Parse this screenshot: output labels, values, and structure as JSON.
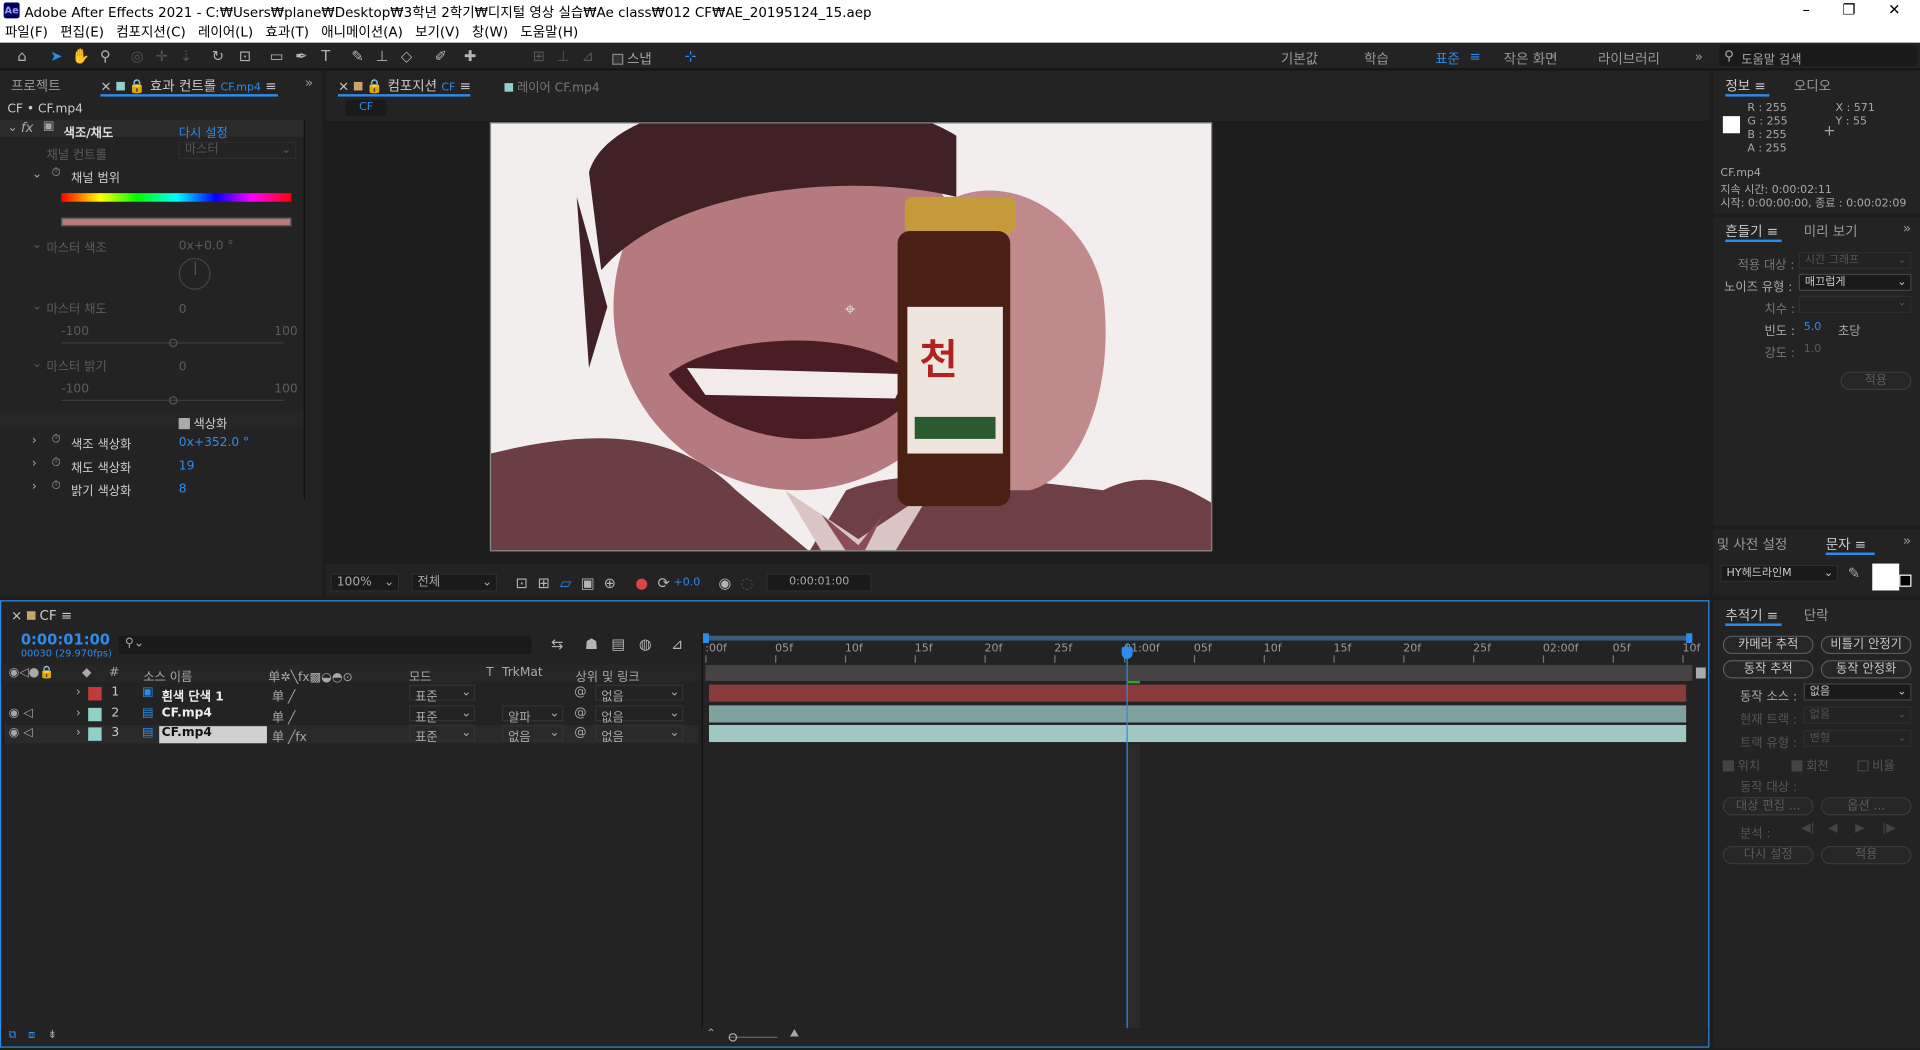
{
  "app": {
    "logo": "Ae",
    "title": "Adobe After Effects 2021 - C:₩Users₩plane₩Desktop₩3학년 2학기₩디지털 영상 실습₩Ae class₩012 CF₩AE_20195124_15.aep"
  },
  "menu": [
    "파일(F)",
    "편집(E)",
    "컴포지션(C)",
    "레이어(L)",
    "효과(T)",
    "애니메이션(A)",
    "보기(V)",
    "창(W)",
    "도움말(H)"
  ],
  "toolbar": {
    "snap_label": "스냅",
    "workspaces": [
      "기본값",
      "학습",
      "표준",
      "작은 화면",
      "라이브러리"
    ],
    "active_workspace": "표준",
    "search_placeholder": "도움말 검색"
  },
  "left_panel": {
    "tabs": [
      "프로젝트",
      "효과 컨트롤"
    ],
    "effect_tab_suffix": "CF.mp4",
    "layer_path": "CF • CF.mp4",
    "effect_name": "색조/채도",
    "reset": "다시 설정",
    "rows": {
      "channel_control": "채널 컨트롤",
      "channel_control_value": "마스터",
      "channel_range": "채널 범위",
      "master_hue": "마스터 색조",
      "master_hue_value": "0x+0.0 °",
      "master_sat": "마스터 채도",
      "master_sat_value": "0",
      "master_light": "마스터 밝기",
      "master_light_value": "0",
      "min": "-100",
      "max": "100",
      "colorize": "색상화",
      "colorize_hue": "색조 색상화",
      "colorize_hue_value": "0x+352.0 °",
      "colorize_sat": "채도 색상화",
      "colorize_sat_value": "19",
      "colorize_light": "밝기 색상화",
      "colorize_light_value": "8"
    }
  },
  "viewer": {
    "tab": "컴포지션",
    "tab_suffix": "CF",
    "layer_tab": "레이어 CF.mp4",
    "sub_tab": "CF",
    "zoom": "100%",
    "resolution": "전체",
    "exposure": "+0.0",
    "timecode": "0:00:01:00"
  },
  "info": {
    "tabs": [
      "정보",
      "오디오"
    ],
    "r": "R : 255",
    "g": "G : 255",
    "b": "B : 255",
    "a": "A : 255",
    "x": "X : 571",
    "y": "Y : 55",
    "file": "CF.mp4",
    "duration": "지속 시간: 0:00:02:11",
    "start": "시작: 0:00:00:00, 종료 : 0:00:02:09"
  },
  "wiggler": {
    "tabs": [
      "흔들기",
      "미리 보기"
    ],
    "apply_to": "적용 대상 :",
    "apply_to_value": "시간 그래프",
    "noise": "노이즈 유형 :",
    "noise_value": "매끄럽게",
    "dimension": "치수 :",
    "freq": "빈도 :",
    "freq_value": "5.0",
    "freq_unit": "초당",
    "strength": "강도 :",
    "strength_value": "1.0",
    "apply": "적용"
  },
  "char": {
    "tabs": [
      "및 사전 설정",
      "문자"
    ],
    "font": "HY헤드라인M"
  },
  "tracker": {
    "tabs": [
      "추적기",
      "단락"
    ],
    "buttons": [
      "카메라 추적",
      "비틀기 안정기",
      "동작 추적",
      "동작 안정화"
    ],
    "motion_source": "동작 소스 :",
    "motion_source_value": "없음",
    "current_track": "현재 트랙 :",
    "current_track_value": "없음",
    "track_type": "트랙 유형 :",
    "track_type_value": "변형",
    "position": "위치",
    "rotation": "회전",
    "scale": "비율",
    "motion_target": "동작 대상 :",
    "edit_target": "대상 편집 ...",
    "options": "옵션 ...",
    "analyze": "분석 :",
    "reset": "다시 설정",
    "apply": "적용"
  },
  "timeline": {
    "comp": "CF",
    "timecode": "0:00:01:00",
    "frames": "00030 (29.970fps)",
    "cols": {
      "source": "소스 이름",
      "mode": "모드",
      "t": "T",
      "trkmat": "TrkMat",
      "parent": "상위 및 링크"
    },
    "layers": [
      {
        "num": "1",
        "name": "흰색 단색 1",
        "color": "#c23b3b",
        "mode": "표준",
        "trk": "",
        "parent": "없음"
      },
      {
        "num": "2",
        "name": "CF.mp4",
        "color": "#8fd0c9",
        "mode": "표준",
        "trk": "알파",
        "parent": "없음"
      },
      {
        "num": "3",
        "name": "CF.mp4",
        "color": "#8fd0c9",
        "mode": "표준",
        "trk": "없음",
        "parent": "없음"
      }
    ],
    "ruler": [
      ":00f",
      "05f",
      "10f",
      "15f",
      "20f",
      "25f",
      "01:00f",
      "05f",
      "10f",
      "15f",
      "20f",
      "25f",
      "02:00f",
      "05f",
      "10f"
    ]
  },
  "colors": {
    "accent": "#2d8ceb",
    "layer1": "#8a3a3a",
    "layer23": "#8fb8b2"
  }
}
